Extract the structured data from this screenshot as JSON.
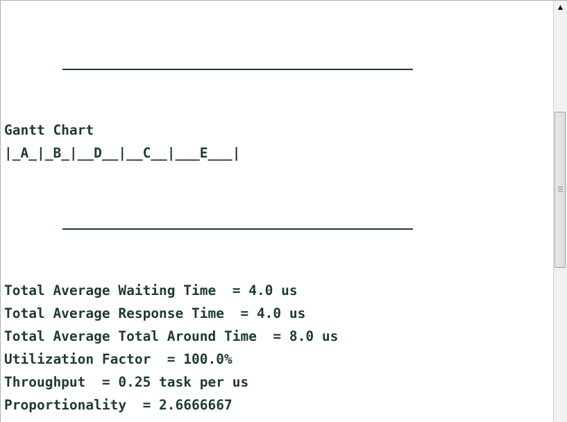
{
  "gantt": {
    "title": "Gantt Chart",
    "bar": "|_A_|_B_|__D__|__C__|___E___|"
  },
  "stats": {
    "waiting": "Total Average Waiting Time  = 4.0 us",
    "response": "Total Average Response Time  = 4.0 us",
    "turnaround": "Total Average Total Around Time  = 8.0 us",
    "utilization": "Utilization Factor  = 100.0%",
    "throughput": "Throughput  = 0.25 task per us",
    "proportionality": "Proportionality  = 2.6666667"
  },
  "scrollbar": {
    "up_arrow": "▲",
    "up_icon": "triangle-up-icon"
  }
}
